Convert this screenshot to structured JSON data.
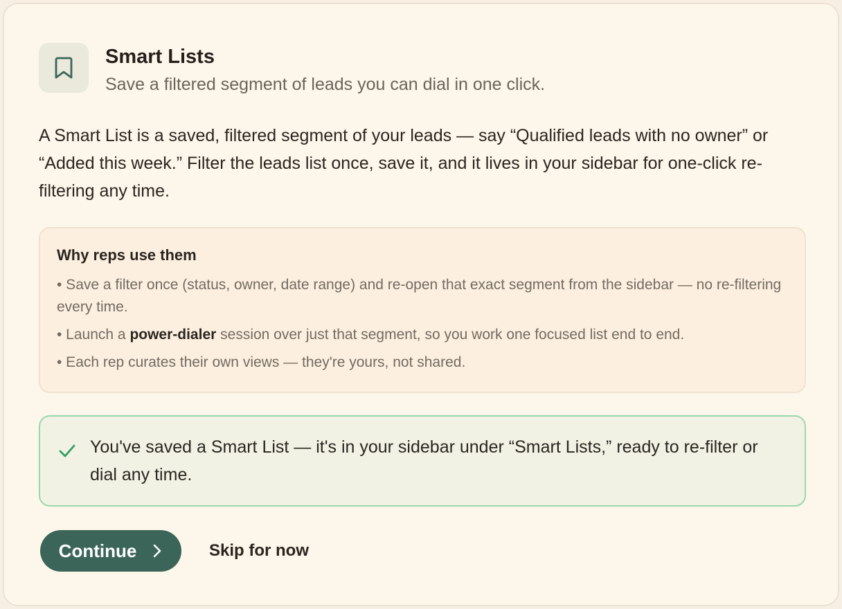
{
  "header": {
    "icon": "bookmark-icon",
    "title": "Smart Lists",
    "subtitle": "Save a filtered segment of leads you can dial in one click."
  },
  "intro": "A Smart List is a saved, filtered segment of your leads — say “Qualified leads with no owner” or “Added this week.” Filter the leads list once, save it, and it lives in your sidebar for one-click re-filtering any time.",
  "why": {
    "title": "Why reps use them",
    "items": [
      {
        "text": "• Save a filter once (status, owner, date range) and re-open that exact segment from the sidebar — no re-filtering every time."
      },
      {
        "before": "• Launch a ",
        "bold": "power-dialer",
        "after": " session over just that segment, so you work one focused list end to end."
      },
      {
        "text": "• Each rep curates their own views — they're yours, not shared."
      }
    ]
  },
  "success": {
    "icon": "check-icon",
    "text": "You've saved a Smart List — it's in your sidebar under “Smart Lists,” ready to re-filter or dial any time."
  },
  "actions": {
    "continue_label": "Continue",
    "continue_icon": "chevron-right-icon",
    "skip_label": "Skip for now"
  },
  "colors": {
    "accent": "#3b6558",
    "success_border": "#9ad8ac",
    "success_check": "#2f9e63"
  }
}
